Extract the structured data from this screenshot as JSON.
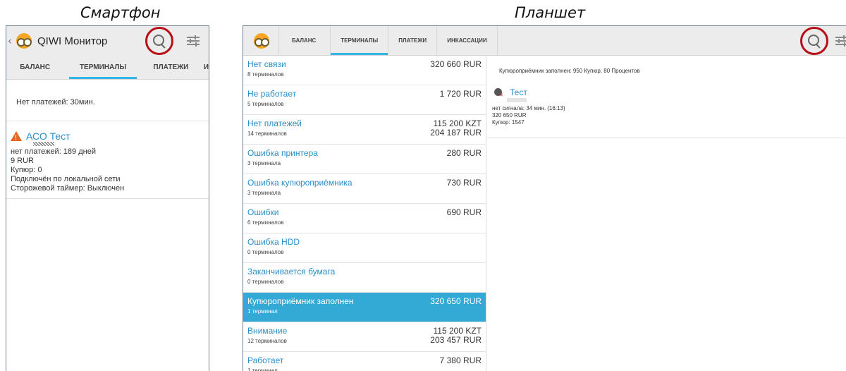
{
  "captions": {
    "phone": "Смартфон",
    "tablet": "Планшет"
  },
  "phone": {
    "title": "QIWI Монитор",
    "tabs": [
      "БАЛАНС",
      "ТЕРМИНАЛЫ",
      "ПЛАТЕЖИ",
      "И"
    ],
    "active_tab": "ТЕРМИНАЛЫ",
    "message": "Нет платежей: 30мин.",
    "terminal": {
      "name": "АСО Тест",
      "lines": [
        "нет платежей: 189 дней",
        "9 RUR",
        "Купюр: 0",
        "Подключён по локальной сети",
        "Сторожевой таймер: Выключен"
      ]
    }
  },
  "tablet": {
    "tabs": [
      "БАЛАНС",
      "ТЕРМИНАЛЫ",
      "ПЛАТЕЖИ",
      "ИНКАССАЦИИ"
    ],
    "active_tab": "ТЕРМИНАЛЫ",
    "list": [
      {
        "name": "Нет связи",
        "count": "8 терминалов",
        "amounts": [
          "320 660 RUR"
        ]
      },
      {
        "name": "Не работает",
        "count": "5 терминалов",
        "amounts": [
          "1 720 RUR"
        ]
      },
      {
        "name": "Нет платежей",
        "count": "14 терминалов",
        "amounts": [
          "115 200 KZT",
          "204 187 RUR"
        ]
      },
      {
        "name": "Ошибка принтера",
        "count": "3 терминала",
        "amounts": [
          "280 RUR"
        ]
      },
      {
        "name": "Ошибка купюроприёмника",
        "count": "3 терминала",
        "amounts": [
          "730 RUR"
        ]
      },
      {
        "name": "Ошибки",
        "count": "6 терминалов",
        "amounts": [
          "690 RUR"
        ]
      },
      {
        "name": "Ошибка HDD",
        "count": "0 терминалов",
        "amounts": []
      },
      {
        "name": "Заканчивается бумага",
        "count": "0 терминалов",
        "amounts": []
      },
      {
        "name": "Купюроприёмник заполнен",
        "count": "1 терминал",
        "amounts": [
          "320 650 RUR"
        ],
        "selected": true
      },
      {
        "name": "Внимание",
        "count": "12 терминалов",
        "amounts": [
          "115 200 KZT",
          "203 457 RUR"
        ]
      },
      {
        "name": "Работает",
        "count": "1 терминал",
        "amounts": [
          "7 380 RUR"
        ]
      }
    ],
    "detail": {
      "message": "Купюроприёмник заполнен: 950 Купюр, 80 Процентов",
      "terminal": {
        "name": "Тест",
        "lines": [
          "нет сигнала: 34 мин. (16:13)",
          "320 650 RUR",
          "Купюр: 1547"
        ]
      }
    }
  },
  "colors": {
    "accent": "#33b5e5",
    "highlight_circle": "#b80f17",
    "link": "#2a8fc8",
    "selected_row": "#33a9d6"
  }
}
